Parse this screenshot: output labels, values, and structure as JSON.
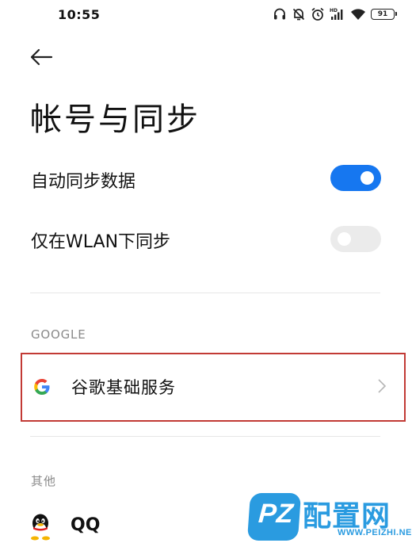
{
  "status_bar": {
    "time": "10:55",
    "battery": "91",
    "icons": [
      "headphones-icon",
      "vibrate-off-icon",
      "alarm-icon",
      "hd-signal-icon",
      "wifi-icon",
      "battery-icon"
    ]
  },
  "header": {
    "back_icon": "arrow-left-icon",
    "title": "帐号与同步"
  },
  "sync": {
    "auto_sync_label": "自动同步数据",
    "auto_sync_on": true,
    "wlan_only_label": "仅在WLAN下同步",
    "wlan_only_on": false
  },
  "sections": {
    "google_header": "GOOGLE",
    "google_item_label": "谷歌基础服务",
    "other_header": "其他",
    "qq_label": "QQ"
  },
  "colors": {
    "accent": "#1677f0",
    "highlight_border": "#c23a35",
    "watermark": "#2a9be0"
  },
  "watermark": {
    "badge": "PZ",
    "name": "配置网",
    "url": "WWW.PEIZHI.NET"
  }
}
